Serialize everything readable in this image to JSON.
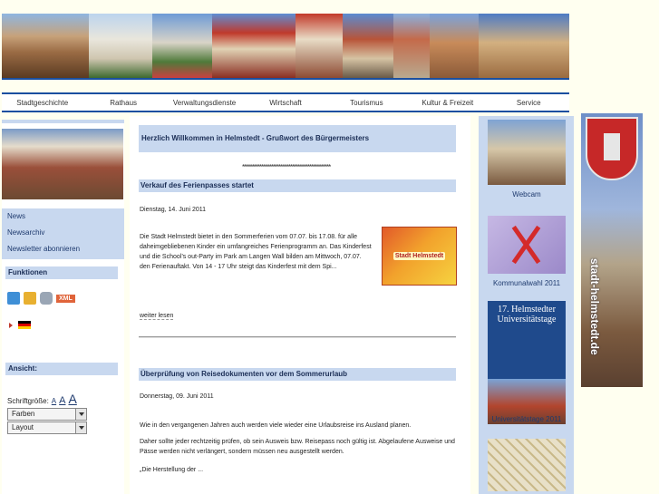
{
  "nav": {
    "items": [
      "Stadtgeschichte",
      "Rathaus",
      "Verwaltungsdienste",
      "Wirtschaft",
      "Tourismus",
      "Kultur & Freizeit",
      "Service"
    ]
  },
  "left": {
    "menu": [
      "News",
      "Newsarchiv",
      "Newsletter abonnieren"
    ],
    "functions_heading": "Funktionen",
    "functions_icons": [
      "home-icon",
      "favorites-icon",
      "print-icon",
      "xml-feed-icon"
    ],
    "xml_label": "XML",
    "language_flag": "german-flag-icon",
    "view_heading": "Ansicht:",
    "font_size_label": "Schriftgröße:",
    "font_size_options": [
      "A",
      "A",
      "A"
    ],
    "colors_select": "Farben",
    "layout_select": "Layout"
  },
  "main": {
    "welcome_title": "Herzlich Willkommen in Helmstedt - Grußwort des Bürgermeisters",
    "separator": "**********************************************",
    "articles": [
      {
        "title": "Verkauf des Ferienpasses startet",
        "date": "Dienstag, 14. Juni 2011",
        "text": "Die Stadt Helmstedt bietet in den Sommerferien vom 07.07. bis 17.08. für alle daheimgebliebenen Kinder ein umfangreiches Ferienprogramm an. Das Kinderfest und die School’s out-Party im Park am Langen Wall bilden am Mittwoch, 07.07. den Ferienauftakt. Von 14 - 17 Uhr steigt das Kinderfest mit dem Spi...",
        "image_label": "Stadt Helmstedt",
        "more": "weiter lesen"
      },
      {
        "title": "Überprüfung von Reisedokumenten vor dem Sommerurlaub",
        "date": "Donnerstag, 09. Juni 2011",
        "p1": "Wie in den vergangenen Jahren auch werden viele wieder eine Urlaubsreise ins Ausland planen.",
        "p2": "Daher sollte jeder rechtzeitig prüfen, ob sein Ausweis bzw. Reisepass noch gültig ist. Abgelaufene Ausweise und Pässe werden nicht verlängert, sondern müssen neu ausgestellt werden.",
        "p3": "„Die Herstellung der ..."
      }
    ]
  },
  "right": {
    "webcam": "Webcam",
    "wahl": "Kommunalwahl 2011",
    "unitag_image_title": "17. Helmstedter Universitätstage",
    "unitag": "Universitätstage 2011"
  },
  "side_banner": {
    "url_text": "stadt-helmstedt.de"
  }
}
